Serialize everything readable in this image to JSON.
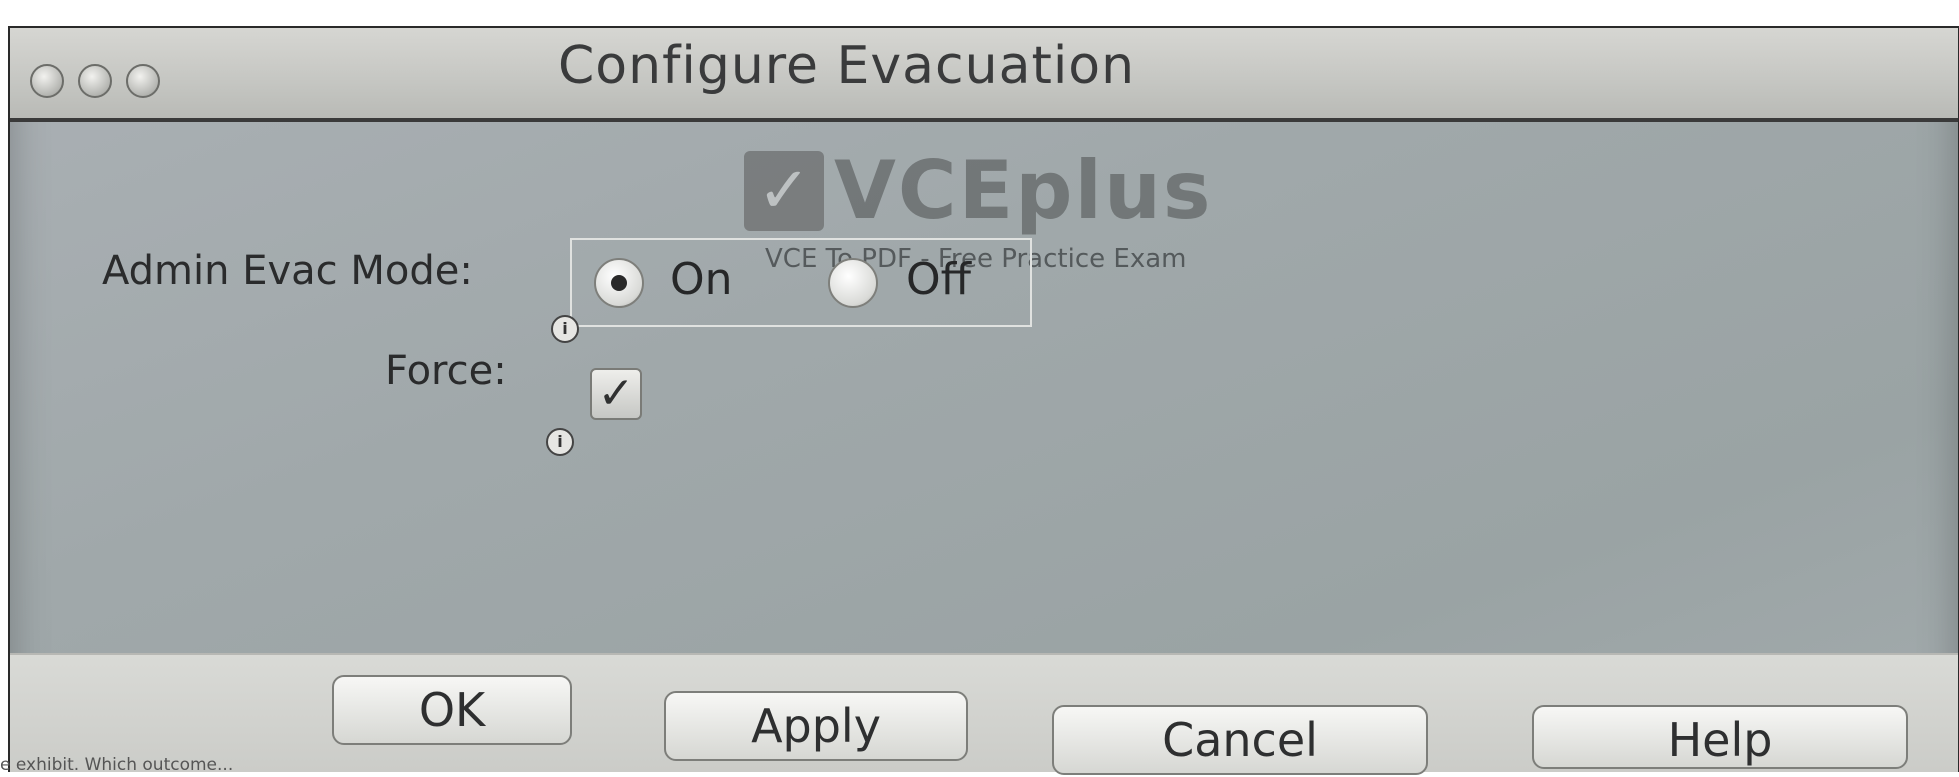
{
  "window": {
    "title": "Configure Evacuation"
  },
  "watermark": {
    "brand": "VCEplus",
    "tagline": "VCE To PDF - Free Practice Exam"
  },
  "form": {
    "admin_evac_mode_label": "Admin Evac Mode:",
    "radio_on_label": "On",
    "radio_off_label": "Off",
    "selected_mode": "On",
    "force_label": "Force:",
    "force_checked": true
  },
  "buttons": {
    "ok": "OK",
    "apply": "Apply",
    "cancel": "Cancel",
    "help": "Help"
  },
  "caption": "e exhibit. Which outcome..."
}
